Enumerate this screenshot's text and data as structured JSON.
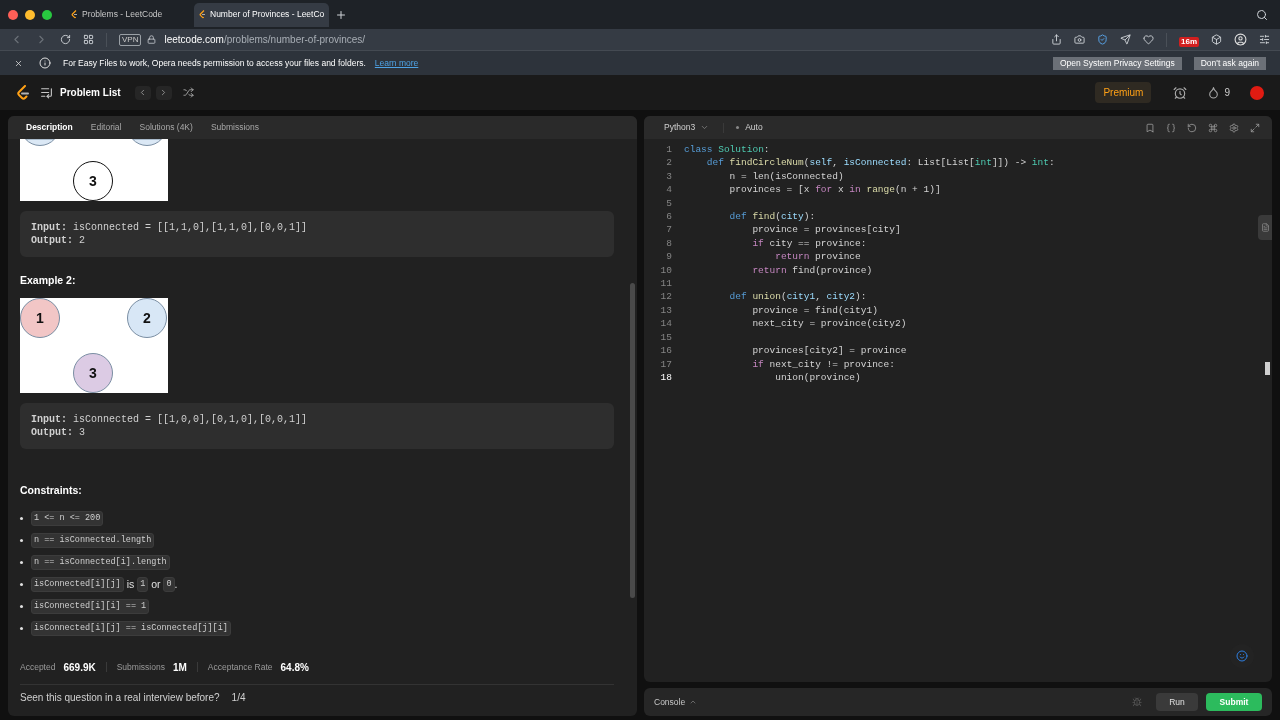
{
  "browser": {
    "tabs": [
      {
        "title": "Problems - LeetCode",
        "selected": false
      },
      {
        "title": "Number of Provinces - LeetCo",
        "selected": true
      }
    ],
    "address": {
      "vpn": "VPN",
      "domain": "leetcode.com",
      "path": "/problems/number-of-provinces/"
    },
    "badge": "16m",
    "notice": {
      "message": "For Easy Files to work, Opera needs permission to access your files and folders.",
      "link": "Learn more",
      "buttons": [
        "Open System Privacy Settings",
        "Don't ask again"
      ]
    }
  },
  "nav": {
    "title": "Problem List",
    "premium": "Premium",
    "streak": "9"
  },
  "description": {
    "tabs": [
      {
        "label": "Description",
        "selected": true
      },
      {
        "label": "Editorial",
        "selected": false
      },
      {
        "label": "Solutions (4K)",
        "selected": false
      },
      {
        "label": "Submissions",
        "selected": false
      }
    ],
    "blocks": [
      {
        "kind": "figure",
        "cropped": true,
        "nodes": [
          {
            "color": "#dbe8f5"
          },
          {
            "color": "#dbe8f5"
          },
          {
            "label": "3",
            "color": "#ffffff"
          }
        ]
      },
      {
        "kind": "example",
        "input": "**Input:** isConnected = [[1,1,0],[1,1,0],[0,0,1]]",
        "output": "**Output:** 2"
      },
      {
        "kind": "heading",
        "text": "Example 2:"
      },
      {
        "kind": "figure",
        "cropped": false,
        "nodes": [
          {
            "label": "1",
            "color": "#f2c6c6"
          },
          {
            "label": "2",
            "color": "#d8e7f6"
          },
          {
            "label": "3",
            "color": "#dccbe4"
          }
        ]
      },
      {
        "kind": "example",
        "input": "**Input:** isConnected = [[1,0,0],[0,1,0],[0,0,1]]",
        "output": "**Output:** 3"
      },
      {
        "kind": "heading",
        "text": "Constraints:"
      },
      {
        "kind": "bullets",
        "items": [
          [
            {
              "text": "1 <= n <= 200",
              "kind": "code"
            }
          ],
          [
            {
              "text": "n == isConnected.length",
              "kind": "code"
            }
          ],
          [
            {
              "text": "n == isConnected[i].length",
              "kind": "code"
            }
          ],
          [
            {
              "text": "isConnected[i][j]",
              "kind": "code"
            },
            {
              "text": " is ",
              "kind": "text"
            },
            {
              "text": "1",
              "kind": "code"
            },
            {
              "text": " or ",
              "kind": "text"
            },
            {
              "text": "0",
              "kind": "code"
            },
            {
              "text": ".",
              "kind": "text"
            }
          ],
          [
            {
              "text": "isConnected[i][i] == 1",
              "kind": "code"
            }
          ],
          [
            {
              "text": "isConnected[i][j] == isConnected[j][i]",
              "kind": "code"
            }
          ]
        ]
      }
    ],
    "stats": [
      {
        "label": "Accepted",
        "value": "669.9K"
      },
      {
        "label": "Submissions",
        "value": "1M"
      },
      {
        "label": "Acceptance Rate",
        "value": "64.8%"
      }
    ],
    "question": "Seen this question in a real interview before?",
    "question_count": "1/4"
  },
  "editor": {
    "language": "Python3",
    "mode": "Auto",
    "lines": [
      {
        "number": "1",
        "current": false,
        "tokens": [
          {
            "text": "class ",
            "kind": "k"
          },
          {
            "text": "Solution",
            "kind": "t"
          },
          {
            "text": ":",
            "kind": "p"
          }
        ]
      },
      {
        "number": "2",
        "current": false,
        "tokens": [
          {
            "text": "    def ",
            "kind": "k"
          },
          {
            "text": "findCircleNum",
            "kind": "f"
          },
          {
            "text": "(",
            "kind": "p"
          },
          {
            "text": "self",
            "kind": "v"
          },
          {
            "text": ", ",
            "kind": "p"
          },
          {
            "text": "isConnected",
            "kind": "v"
          },
          {
            "text": ": List[List[",
            "kind": "p"
          },
          {
            "text": "int",
            "kind": "t"
          },
          {
            "text": "]]) -> ",
            "kind": "p"
          },
          {
            "text": "int",
            "kind": "t"
          },
          {
            "text": ":",
            "kind": "p"
          }
        ]
      },
      {
        "number": "3",
        "current": false,
        "tokens": [
          {
            "text": "        n = len(isConnected)",
            "kind": "p"
          }
        ]
      },
      {
        "number": "4",
        "current": false,
        "tokens": [
          {
            "text": "        provinces = [x ",
            "kind": "p"
          },
          {
            "text": "for",
            "kind": "c"
          },
          {
            "text": " x ",
            "kind": "p"
          },
          {
            "text": "in",
            "kind": "c"
          },
          {
            "text": " range",
            "kind": "f"
          },
          {
            "text": "(n + 1)]",
            "kind": "p"
          }
        ]
      },
      {
        "number": "5",
        "current": false
      },
      {
        "number": "6",
        "current": false,
        "tokens": [
          {
            "text": "        def ",
            "kind": "k"
          },
          {
            "text": "find",
            "kind": "f"
          },
          {
            "text": "(",
            "kind": "p"
          },
          {
            "text": "city",
            "kind": "v"
          },
          {
            "text": "):",
            "kind": "p"
          }
        ]
      },
      {
        "number": "7",
        "current": false,
        "tokens": [
          {
            "text": "            province = provinces[city]",
            "kind": "p"
          }
        ]
      },
      {
        "number": "8",
        "current": false,
        "tokens": [
          {
            "text": "            if",
            "kind": "c"
          },
          {
            "text": " city == province:",
            "kind": "p"
          }
        ]
      },
      {
        "number": "9",
        "current": false,
        "tokens": [
          {
            "text": "                return",
            "kind": "c"
          },
          {
            "text": " province",
            "kind": "p"
          }
        ]
      },
      {
        "number": "10",
        "current": false,
        "tokens": [
          {
            "text": "            return",
            "kind": "c"
          },
          {
            "text": " find(province)",
            "kind": "p"
          }
        ]
      },
      {
        "number": "11",
        "current": false
      },
      {
        "number": "12",
        "current": false,
        "tokens": [
          {
            "text": "        def ",
            "kind": "k"
          },
          {
            "text": "union",
            "kind": "f"
          },
          {
            "text": "(",
            "kind": "p"
          },
          {
            "text": "city1",
            "kind": "v"
          },
          {
            "text": ", ",
            "kind": "p"
          },
          {
            "text": "city2",
            "kind": "v"
          },
          {
            "text": "):",
            "kind": "p"
          }
        ]
      },
      {
        "number": "13",
        "current": false,
        "tokens": [
          {
            "text": "            province = find(city1)",
            "kind": "p"
          }
        ]
      },
      {
        "number": "14",
        "current": false,
        "tokens": [
          {
            "text": "            next_city = province(city2)",
            "kind": "p"
          }
        ]
      },
      {
        "number": "15",
        "current": false
      },
      {
        "number": "16",
        "current": false,
        "tokens": [
          {
            "text": "            provinces[city2] = province",
            "kind": "p"
          }
        ]
      },
      {
        "number": "17",
        "current": false,
        "tokens": [
          {
            "text": "            if",
            "kind": "c"
          },
          {
            "text": " next_city != province:",
            "kind": "p"
          }
        ]
      },
      {
        "number": "18",
        "current": true,
        "tokens": [
          {
            "text": "                union(province)",
            "kind": "p"
          }
        ]
      }
    ],
    "console": "Console",
    "run": "Run",
    "submit": "Submit"
  }
}
